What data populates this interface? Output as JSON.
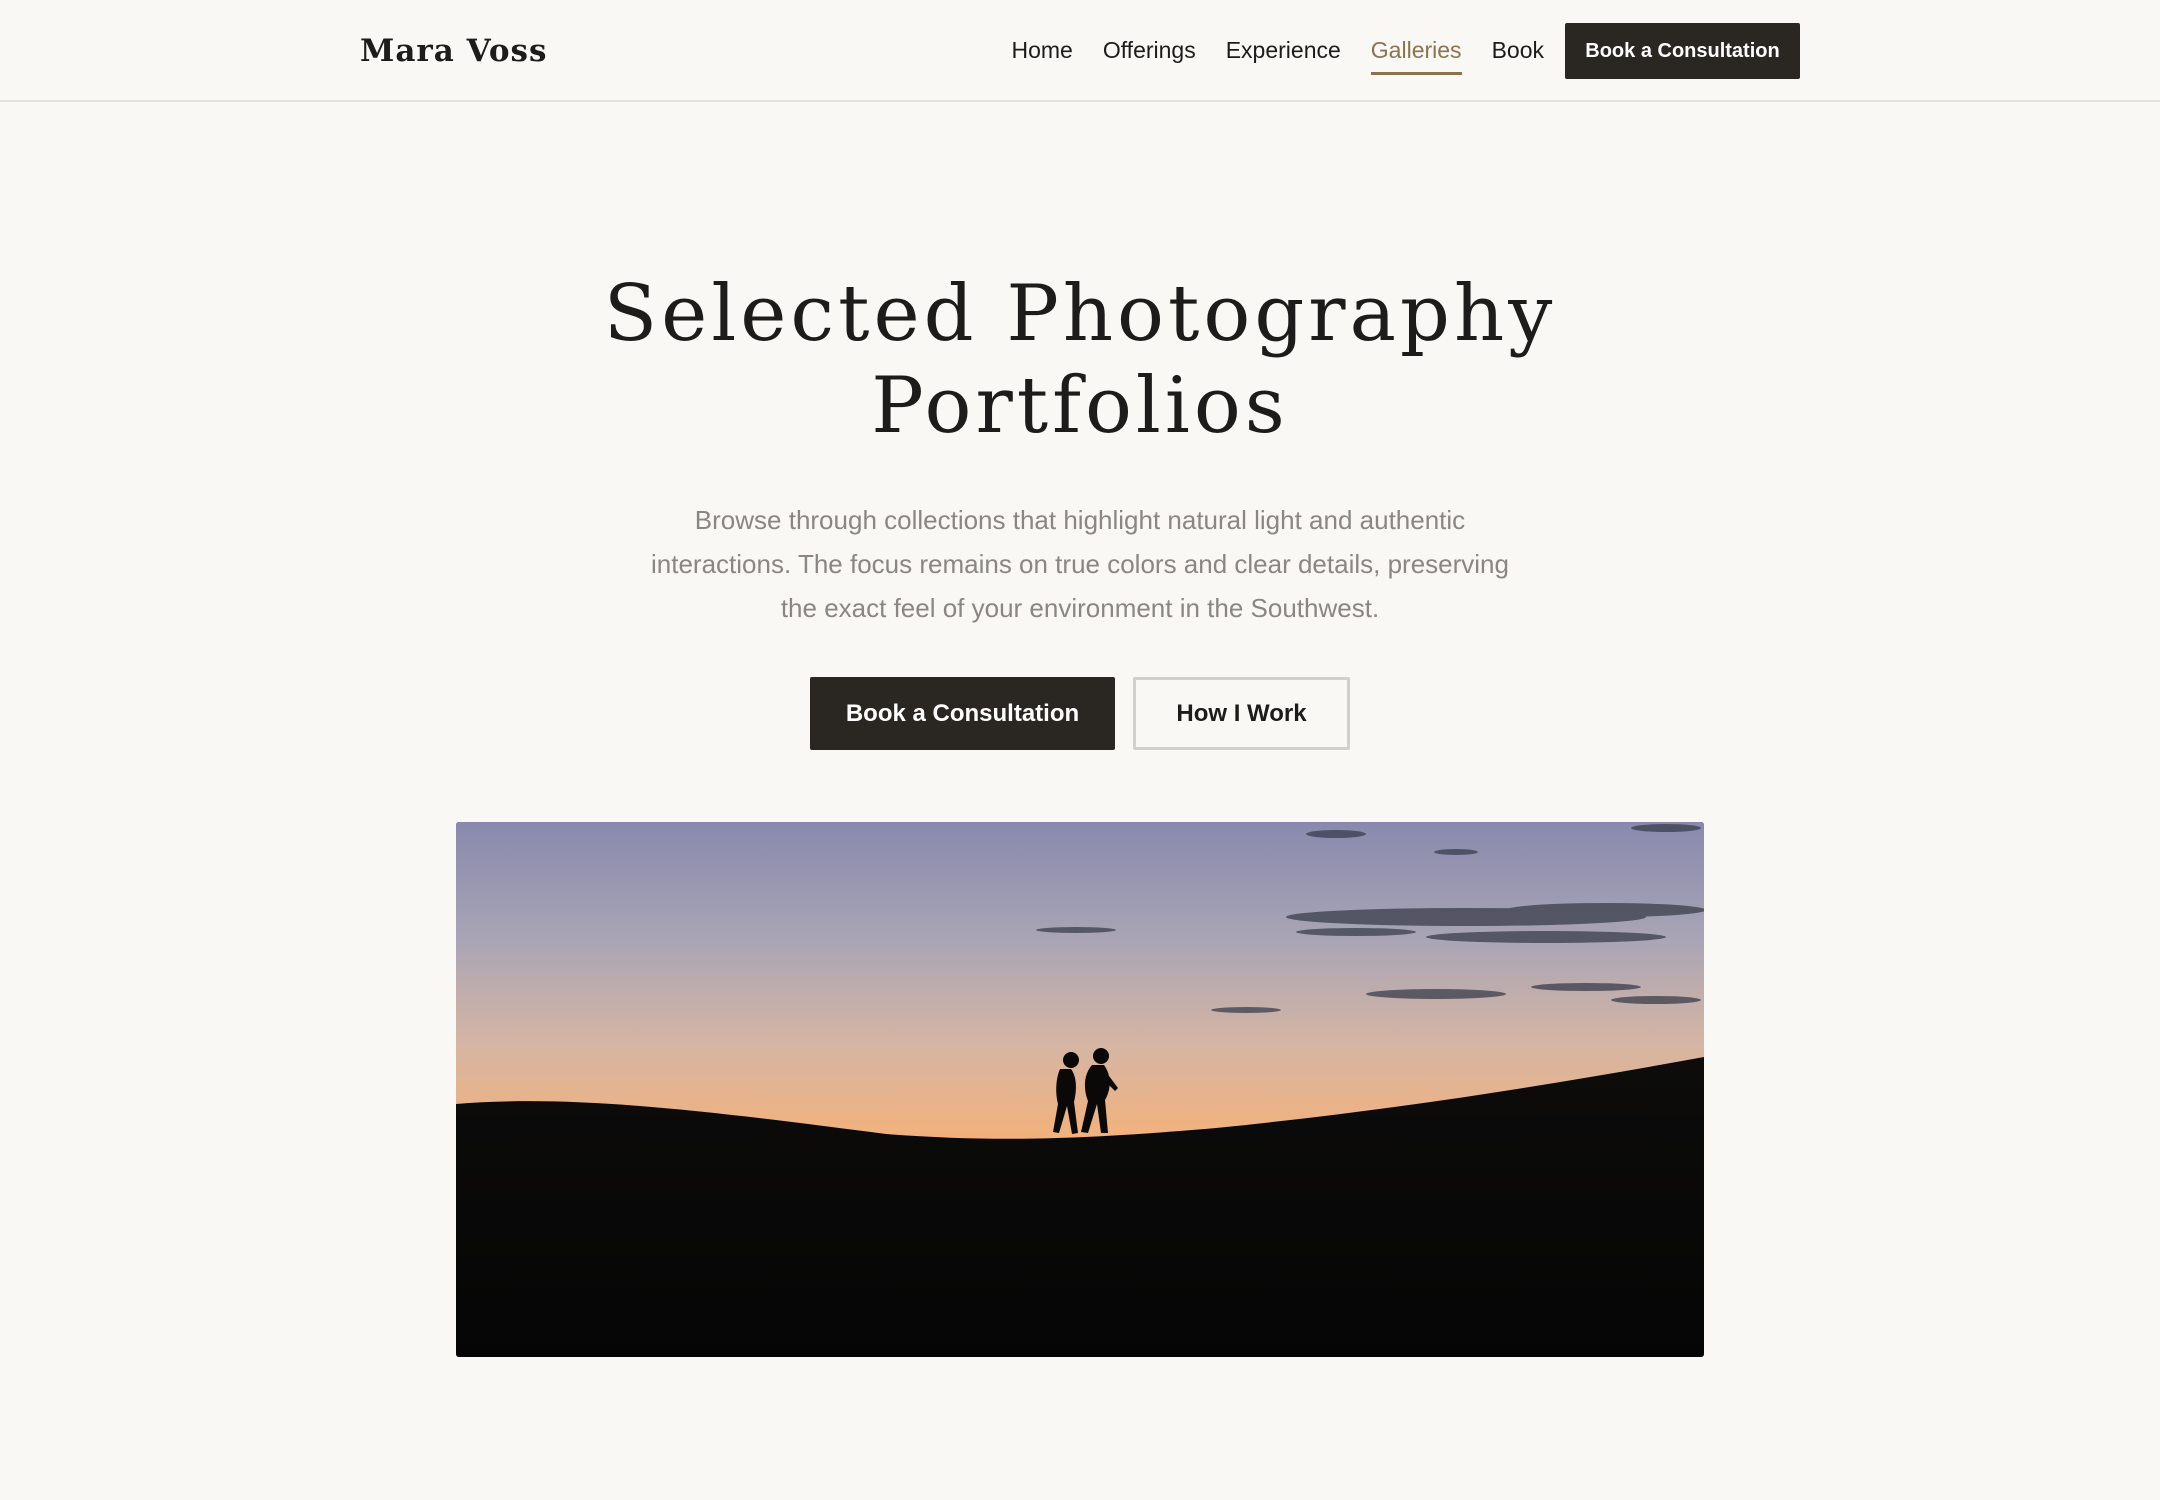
{
  "header": {
    "brand": "Mara Voss",
    "nav": [
      {
        "label": "Home",
        "active": false
      },
      {
        "label": "Offerings",
        "active": false
      },
      {
        "label": "Experience",
        "active": false
      },
      {
        "label": "Galleries",
        "active": true
      },
      {
        "label": "Book",
        "active": false
      }
    ],
    "cta_label": "Book a Consultation"
  },
  "hero": {
    "title_line1": "Selected Photography",
    "title_line2": "Portfolios",
    "subtitle": "Browse through collections that highlight natural light and authentic interactions. The focus remains on true colors and clear details, preserving the exact feel of your environment in the Southwest.",
    "primary_button": "Book a Consultation",
    "secondary_button": "How I Work"
  },
  "photo": {
    "subject": "two-figures-walking-on-dune-at-sunset"
  },
  "colors": {
    "background": "#f9f8f4",
    "text": "#1d1c1a",
    "accent": "#8b7350",
    "button_dark": "#2a2723",
    "muted_text": "#8a8782"
  }
}
